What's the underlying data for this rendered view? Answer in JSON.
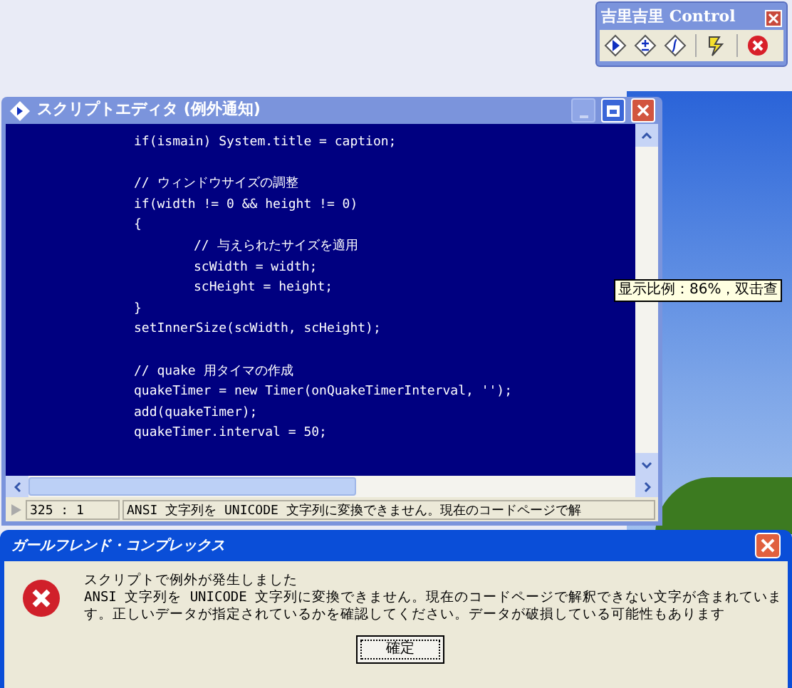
{
  "control_panel": {
    "title": "吉里吉里 Control"
  },
  "editor": {
    "title": "スクリプトエディタ (例外通知)",
    "lines": [
      {
        "kind": "code",
        "text": "if(ismain) System.title = caption;"
      },
      {
        "kind": "blank"
      },
      {
        "kind": "code",
        "text": "// ウィンドウサイズの調整"
      },
      {
        "kind": "code",
        "text": "if(width != 0 && height != 0)"
      },
      {
        "kind": "code",
        "text": "{",
        "children": [
          {
            "kind": "code",
            "text": "// 与えられたサイズを適用"
          },
          {
            "kind": "code",
            "text": "scWidth = width;"
          },
          {
            "kind": "code",
            "text": "scHeight = height;"
          }
        ]
      },
      {
        "kind": "code",
        "text": "}"
      },
      {
        "kind": "code",
        "text": "setInnerSize(scWidth, scHeight);"
      },
      {
        "kind": "blank"
      },
      {
        "kind": "code",
        "text": "// quake 用タイマの作成"
      },
      {
        "kind": "code",
        "text": "quakeTimer = new Timer(onQuakeTimerInterval, '');"
      },
      {
        "kind": "code",
        "text": "add(quakeTimer);"
      },
      {
        "kind": "code",
        "text": "quakeTimer.interval = 50;"
      }
    ],
    "status_bar": {
      "position": "325 : 1",
      "message": "ANSI 文字列を UNICODE 文字列に変換できません。現在のコードページで解"
    }
  },
  "tooltip": {
    "text": "显示比例：86%，双击查"
  },
  "dialog": {
    "title": "ガールフレンド・コンプレックス",
    "heading": "スクリプトで例外が発生しました",
    "message": "ANSI 文字列を UNICODE 文字列に変換できません。現在のコードページで解釈できない文字が含まれています。正しいデータが指定されているかを確認してください。データが破損している可能性もあります",
    "button": "確定"
  }
}
